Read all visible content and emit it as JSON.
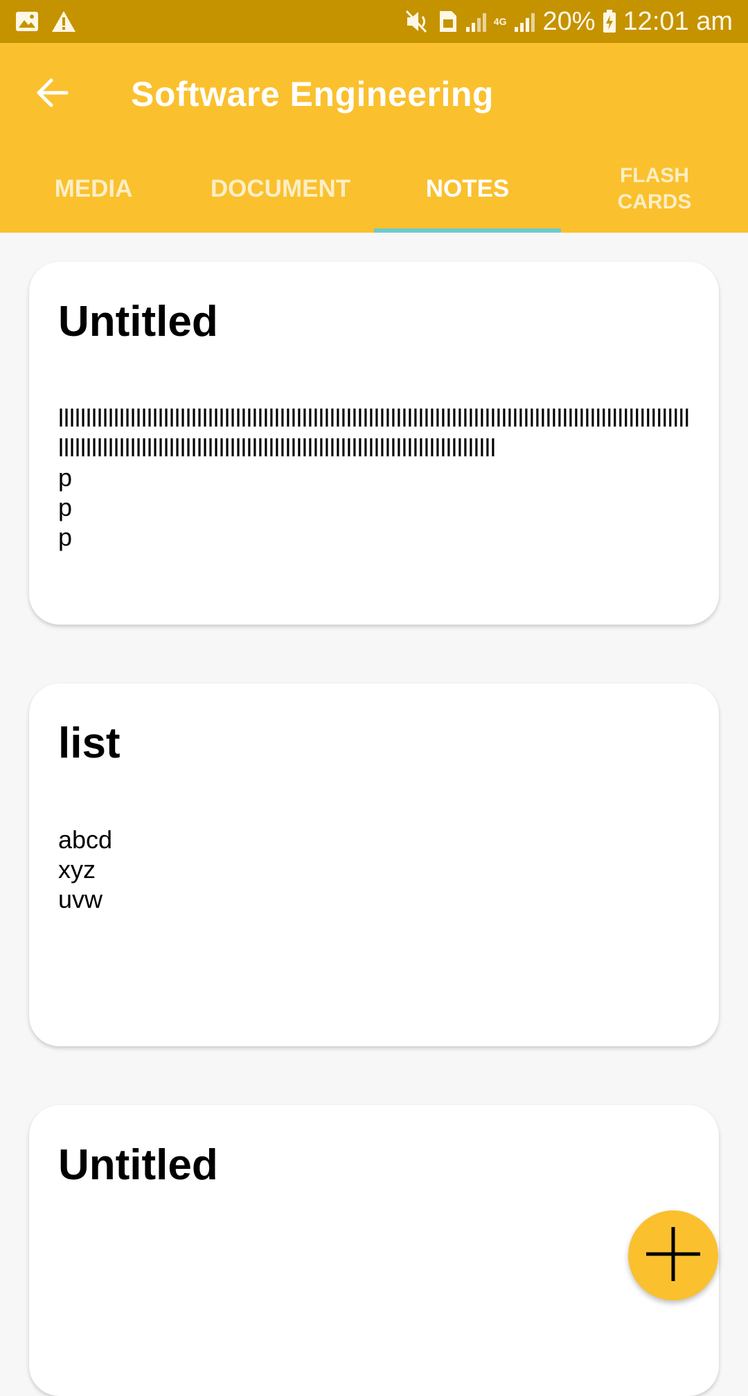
{
  "status_bar": {
    "battery": "20%",
    "time": "12:01 am",
    "network": "4G",
    "icons": [
      "image-icon",
      "warning-icon",
      "mute-icon",
      "sim-icon",
      "signal-icon",
      "battery-icon"
    ]
  },
  "app_bar": {
    "title": "Software Engineering",
    "back_icon": "arrow-left-icon"
  },
  "tabs": [
    {
      "label": "MEDIA"
    },
    {
      "label": "DOCUMENT"
    },
    {
      "label": "NOTES",
      "active": true
    },
    {
      "label": "FLASH\nCARDS"
    }
  ],
  "notes": [
    {
      "title": "Untitled",
      "body": "lllllllllllllllllllllllllllllllllllllllllllllllllllllllllllllllllllllllllllllllllllllllllllllllllllllllllllllllllllllllllllllllllllllllllllllllllllllllllllllllllllllllllllllllllllllllllllllllll\np\np\np"
    },
    {
      "title": "list",
      "body": "abcd\nxyz\nuvw"
    },
    {
      "title": "Untitled",
      "body": ""
    }
  ],
  "fab": {
    "icon": "plus-icon"
  },
  "colors": {
    "status_bar": "#c59300",
    "primary": "#fac02e",
    "tab_indicator": "#6cc9cf",
    "background": "#f7f7f7"
  }
}
